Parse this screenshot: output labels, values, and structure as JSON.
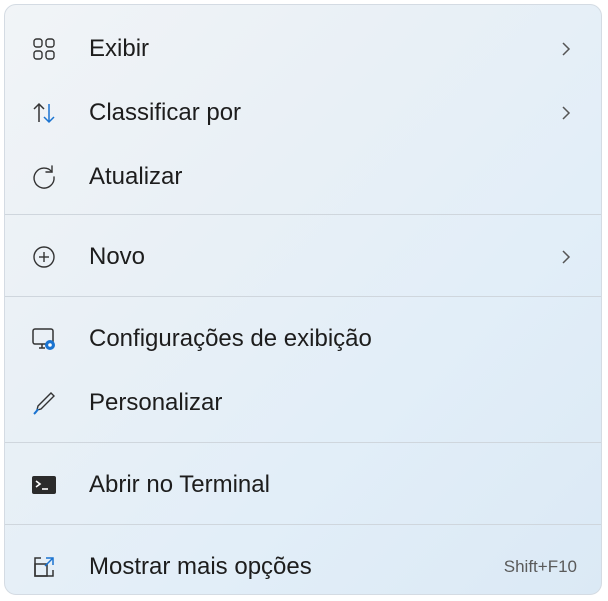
{
  "menu": {
    "items": [
      {
        "label": "Exibir",
        "icon": "grid-view-icon",
        "submenu": true
      },
      {
        "label": "Classificar por",
        "icon": "sort-arrows-icon",
        "submenu": true
      },
      {
        "label": "Atualizar",
        "icon": "refresh-icon",
        "submenu": false
      },
      {
        "label": "Novo",
        "icon": "add-circle-icon",
        "submenu": true
      },
      {
        "label": "Configurações de exibição",
        "icon": "display-settings-icon",
        "submenu": false
      },
      {
        "label": "Personalizar",
        "icon": "pen-brush-icon",
        "submenu": false
      },
      {
        "label": "Abrir no Terminal",
        "icon": "terminal-icon",
        "submenu": false
      },
      {
        "label": "Mostrar mais opções",
        "icon": "open-external-icon",
        "submenu": false,
        "shortcut": "Shift+F10"
      }
    ]
  },
  "colors": {
    "accent": "#1a73d0",
    "text": "#1d1d1d",
    "separator": "#cfd6dd"
  }
}
